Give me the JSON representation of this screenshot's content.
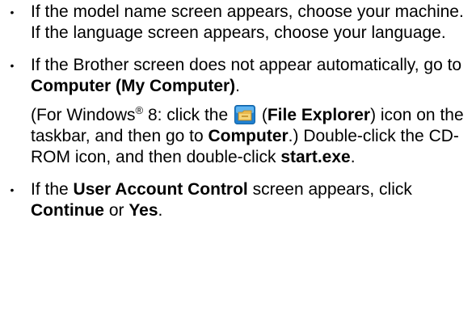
{
  "bullets": [
    {
      "marker": "•",
      "text": "If the model name screen appears, choose your machine. If the language screen appears, choose your language."
    },
    {
      "marker": "•",
      "p1_a": "If the Brother screen does not appear automatically, go to ",
      "p1_b": "Computer (My Computer)",
      "p1_c": ".",
      "p2_a": "(For Windows",
      "p2_sup": "®",
      "p2_b": " 8: click the ",
      "p2_icon": "file-explorer-icon",
      "p2_c": " (",
      "p2_d": "File Explorer",
      "p2_e": ") icon on the taskbar, and then go to ",
      "p2_f": "Computer",
      "p2_g": ".) Double-click the CD-ROM icon, and then double-click ",
      "p2_h": "start.exe",
      "p2_i": "."
    },
    {
      "marker": "•",
      "a": "If the ",
      "b": "User Account Control",
      "c": " screen appears, click ",
      "d": "Continue",
      "e": " or ",
      "f": "Yes",
      "g": "."
    }
  ]
}
